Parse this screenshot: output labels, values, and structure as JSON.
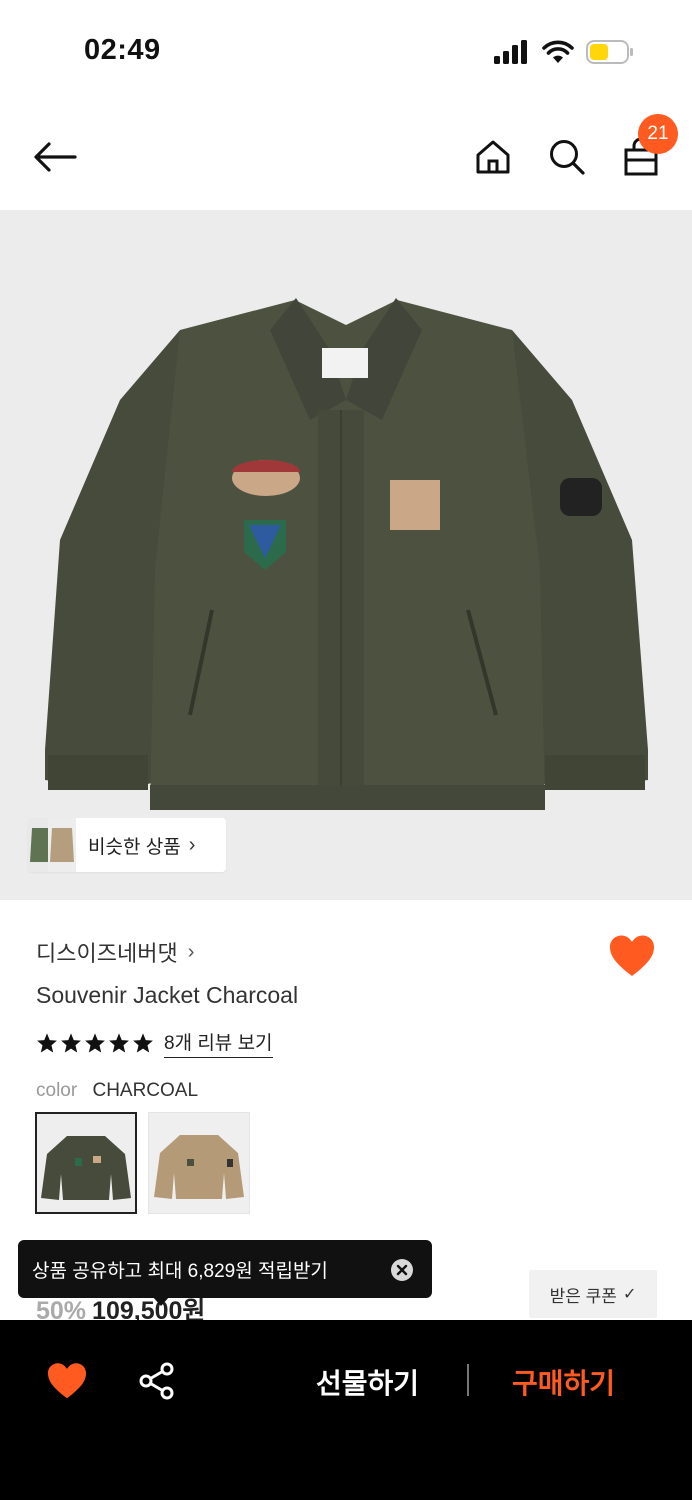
{
  "status_bar": {
    "time": "02:49"
  },
  "header": {
    "cart_count": "21"
  },
  "similar": {
    "label": "비슷한 상품",
    "chevron": "›"
  },
  "product": {
    "brand": "디스이즈네버댓",
    "brand_chevron": "›",
    "name": "Souvenir Jacket Charcoal",
    "review_link": "8개 리뷰 보기",
    "rating": 5,
    "color_key": "color",
    "color_value": "CHARCOAL",
    "swatches": [
      "CHARCOAL",
      "BEIGE"
    ],
    "discount": "50%",
    "price": "109,500원"
  },
  "tooltip": {
    "text": "상품 공유하고 최대 6,829원 적립받기"
  },
  "coupon": {
    "label": "받은 쿠폰",
    "check": "✓"
  },
  "bottom_bar": {
    "gift": "선물하기",
    "buy": "구매하기"
  },
  "colors": {
    "accent": "#ff5a1f",
    "jacket_charcoal": "#4a4f3e",
    "jacket_beige": "#b59a78",
    "image_bg": "#ececec"
  }
}
